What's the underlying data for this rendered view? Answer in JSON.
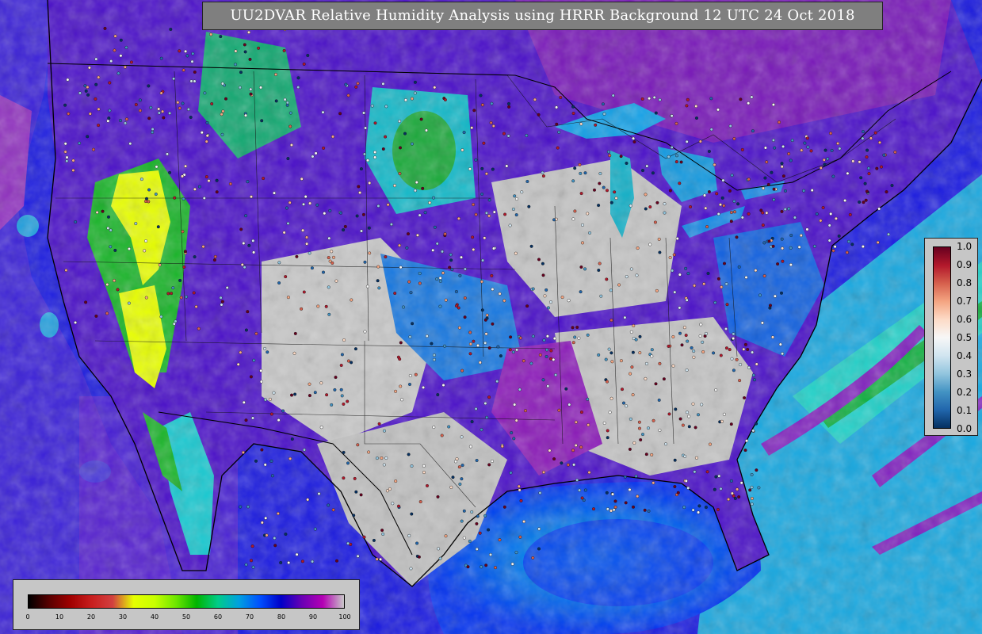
{
  "title": "UU2DVAR Relative Humidity Analysis using HRRR Background 12 UTC 24 Oct 2018",
  "colorbar_humidity": {
    "ticks": [
      "0",
      "10",
      "20",
      "30",
      "40",
      "50",
      "60",
      "70",
      "80",
      "90",
      "100"
    ],
    "colors": [
      "#000000",
      "#5a0000",
      "#a00000",
      "#c81e1e",
      "#d24040",
      "#e6ff00",
      "#c8ff00",
      "#6ee600",
      "#00b400",
      "#00cc88",
      "#00a0e0",
      "#0050ff",
      "#0000c8",
      "#6a00b4",
      "#b400b4",
      "#c8c8c8"
    ]
  },
  "colorbar_obs": {
    "ticks": [
      "1.0",
      "0.9",
      "0.8",
      "0.7",
      "0.6",
      "0.5",
      "0.4",
      "0.3",
      "0.2",
      "0.1",
      "0.0"
    ],
    "colors": [
      "#67001f",
      "#b2182b",
      "#d6604d",
      "#f4a582",
      "#fddbc7",
      "#f7f7f7",
      "#d1e5f0",
      "#92c5de",
      "#4393c3",
      "#2166ac",
      "#053061"
    ]
  },
  "map": {
    "ocean_color": "#0028e0",
    "land_base": "#5a10c8",
    "humid_colors": {
      "dry_yellow": "#e8ff00",
      "green": "#18b428",
      "cyan": "#10c8d8",
      "blue": "#0040ff",
      "purple": "#8c10b4",
      "gray": "#c8c8c8"
    }
  }
}
